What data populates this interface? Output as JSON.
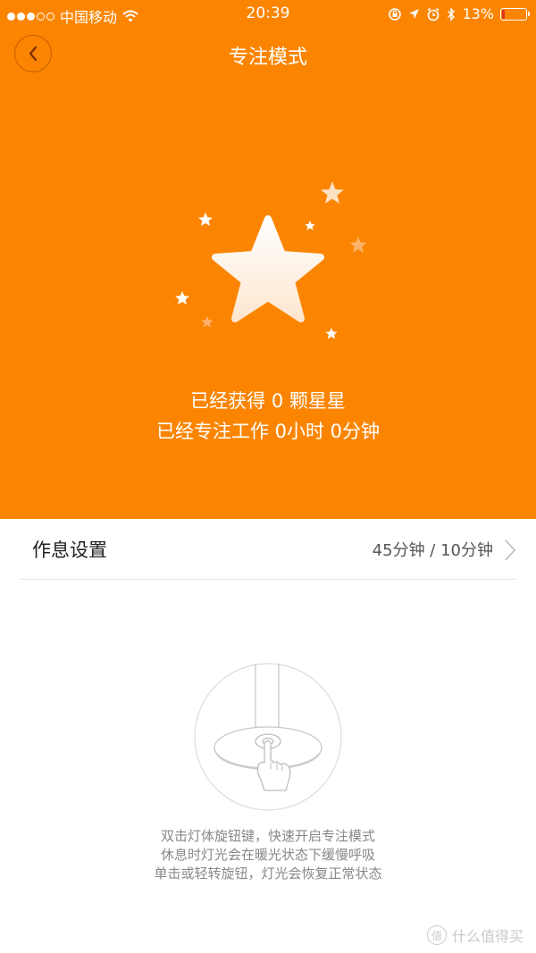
{
  "status_bar": {
    "carrier": "中国移动",
    "time": "20:39",
    "battery": "13%",
    "battery_level": 0.13,
    "signal_strength": 3,
    "icons": [
      "wifi-icon",
      "orientation-lock-icon",
      "location-arrow-icon",
      "alarm-icon",
      "bluetooth-icon",
      "battery-icon"
    ]
  },
  "nav": {
    "title": "专注模式",
    "back_icon": "chevron-left-icon"
  },
  "stats": {
    "stars_text": "已经获得 0 颗星星",
    "work_text": "已经专注工作 0小时 0分钟"
  },
  "settings_row": {
    "label": "作息设置",
    "value": "45分钟 / 10分钟",
    "chevron_icon": "chevron-right-icon"
  },
  "illustration": "lamp-knob-press-icon",
  "hint": {
    "line1": "双击灯体旋钮键，快速开启专注模式",
    "line2": "休息时灯光会在暖光状态下缓慢呼吸",
    "line3": "单击或轻转旋钮，灯光会恢复正常状态"
  },
  "watermark": {
    "badge": "值",
    "text": "什么值得买"
  },
  "colors": {
    "accent": "#FB8500",
    "battery_low": "#E0321E",
    "text_primary": "#222222",
    "text_secondary": "#888888"
  }
}
